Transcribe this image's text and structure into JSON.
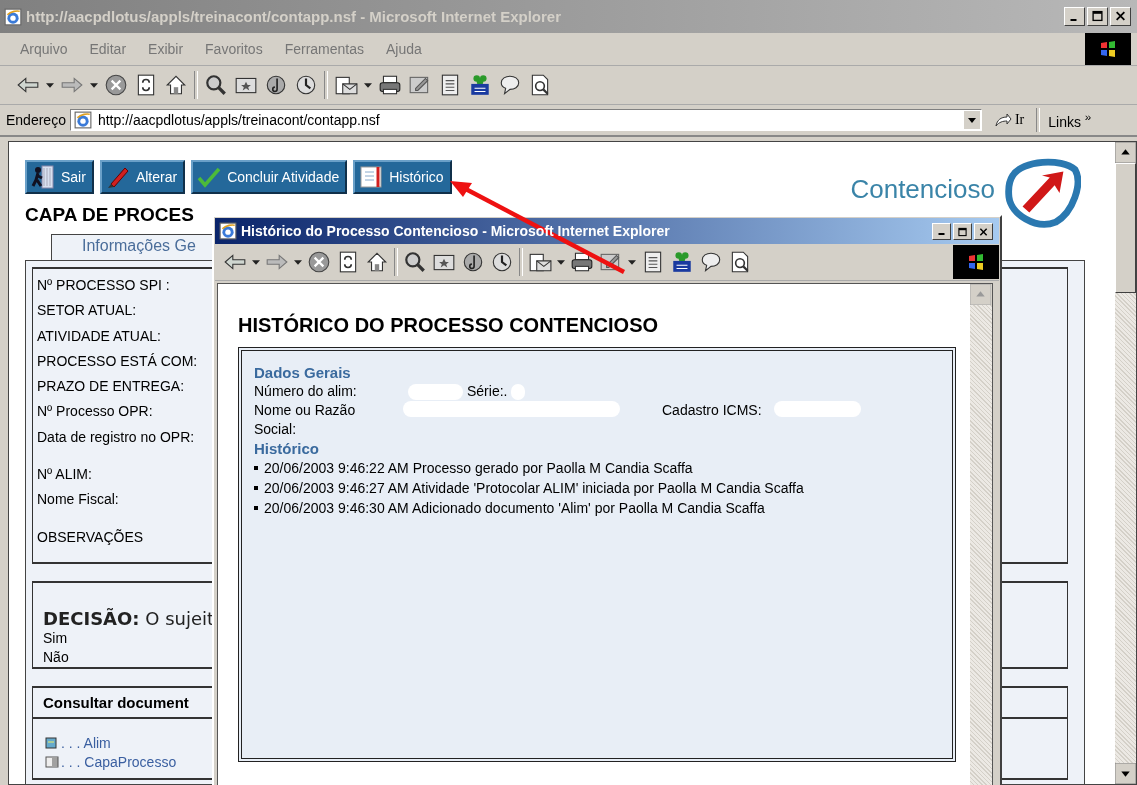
{
  "main_window": {
    "title": "http://aacpdlotus/appls/treinacont/contapp.nsf - Microsoft Internet Explorer",
    "menu": [
      "Arquivo",
      "Editar",
      "Exibir",
      "Favoritos",
      "Ferramentas",
      "Ajuda"
    ],
    "address_label": "Endereço",
    "address": "http://aacpdlotus/appls/treinacont/contapp.nsf",
    "go_label": "Ir",
    "links_label": "Links",
    "links_chevron": "»"
  },
  "page": {
    "buttons": [
      {
        "label": "Sair",
        "kind": "exit"
      },
      {
        "label": "Alterar",
        "kind": "edit"
      },
      {
        "label": "Concluir Atividade",
        "kind": "check"
      },
      {
        "label": "Histórico",
        "kind": "history"
      }
    ],
    "logo_text": "Contencioso",
    "heading": "CAPA DE PROCES",
    "tab": "Informações Ge",
    "field_groups": [
      [
        "Nº PROCESSO SPI :",
        "SETOR ATUAL:",
        "ATIVIDADE ATUAL:",
        "PROCESSO ESTÁ COM:",
        "PRAZO DE ENTREGA:",
        "Nº Processo OPR:",
        "Data de registro no OPR:"
      ],
      [
        "Nº ALIM:",
        "Nome Fiscal:"
      ],
      [
        "OBSERVAÇÕES"
      ]
    ],
    "decision": {
      "label": "DECISÃO:",
      "text": "O sujeit",
      "options": [
        "Sim",
        "Não"
      ]
    },
    "documents": {
      "title": "Consultar document",
      "items": [
        {
          "label": ". . . Alim",
          "kind": "doc"
        },
        {
          "label": ". . . CapaProcesso",
          "kind": "form"
        }
      ]
    }
  },
  "popup": {
    "title": "Histórico do Processo Contencioso - Microsoft Internet Explorer",
    "heading": "HISTÓRICO DO PROCESSO CONTENCIOSO",
    "general_title": "Dados Gerais",
    "number_label": "Número do alim:",
    "series_label": "Série:.",
    "name_label": "Nome ou Razão Social:",
    "icms_label": "Cadastro ICMS:",
    "history_title": "Histórico",
    "history": [
      "20/06/2003 9:46:22 AM Processo gerado por Paolla M Candia Scaffa",
      "20/06/2003 9:46:27 AM Atividade 'Protocolar ALIM' iniciada por Paolla M Candia Scaffa",
      "20/06/2003 9:46:30 AM Adicionado documento 'Alim' por Paolla M Candia Scaffa"
    ]
  }
}
